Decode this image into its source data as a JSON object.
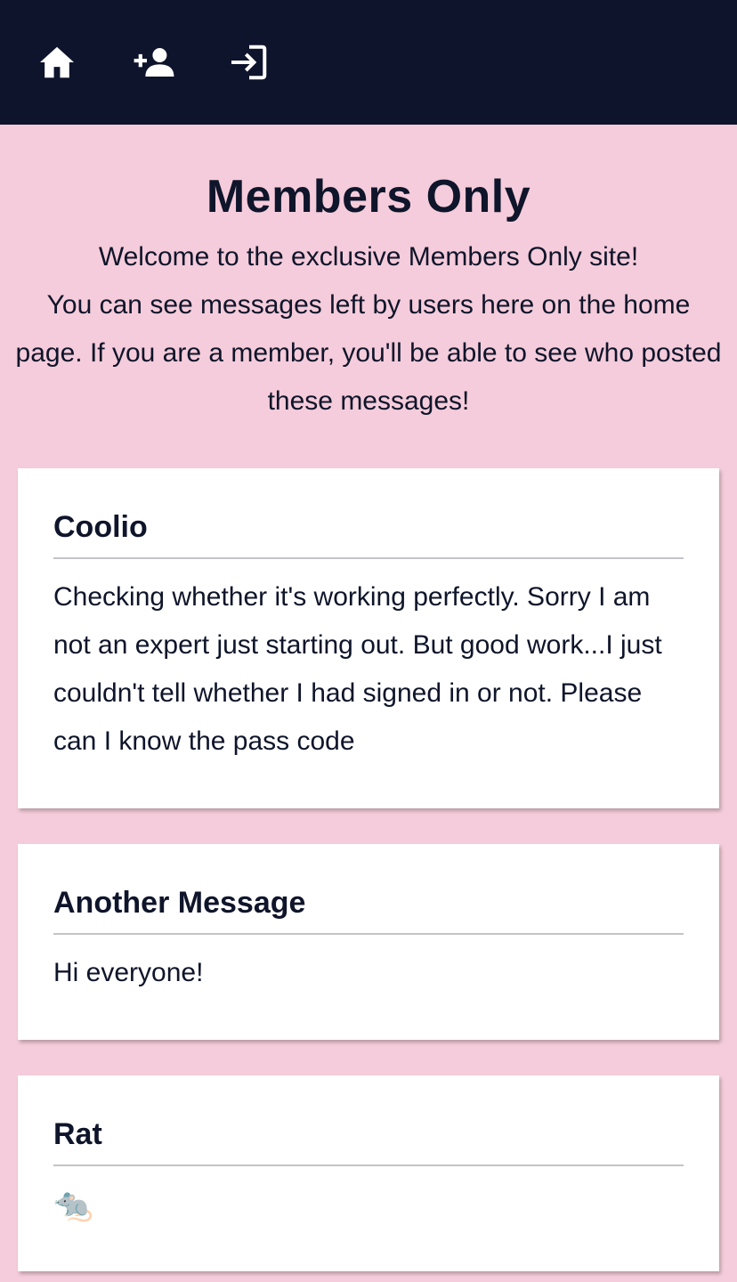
{
  "nav": {
    "items": [
      {
        "icon": "home-icon"
      },
      {
        "icon": "add-user-icon"
      },
      {
        "icon": "login-icon"
      }
    ],
    "background": "#0e142b",
    "icon_color": "#ffffff"
  },
  "page": {
    "background": "#f5ccdb",
    "title": "Members Only",
    "welcome_line1": "Welcome to the exclusive Members Only site!",
    "welcome_line2": "You can see messages left by users here on the home page. If you are a member, you'll be able to see who posted these messages!"
  },
  "messages": [
    {
      "title": "Coolio",
      "body": "Checking whether it's working perfectly. Sorry I am not an expert just starting out. But good work...I just couldn't tell whether I had signed in or not. Please can I know the pass code"
    },
    {
      "title": "Another Message",
      "body": "Hi everyone!"
    },
    {
      "title": "Rat",
      "body": "🐀"
    }
  ]
}
